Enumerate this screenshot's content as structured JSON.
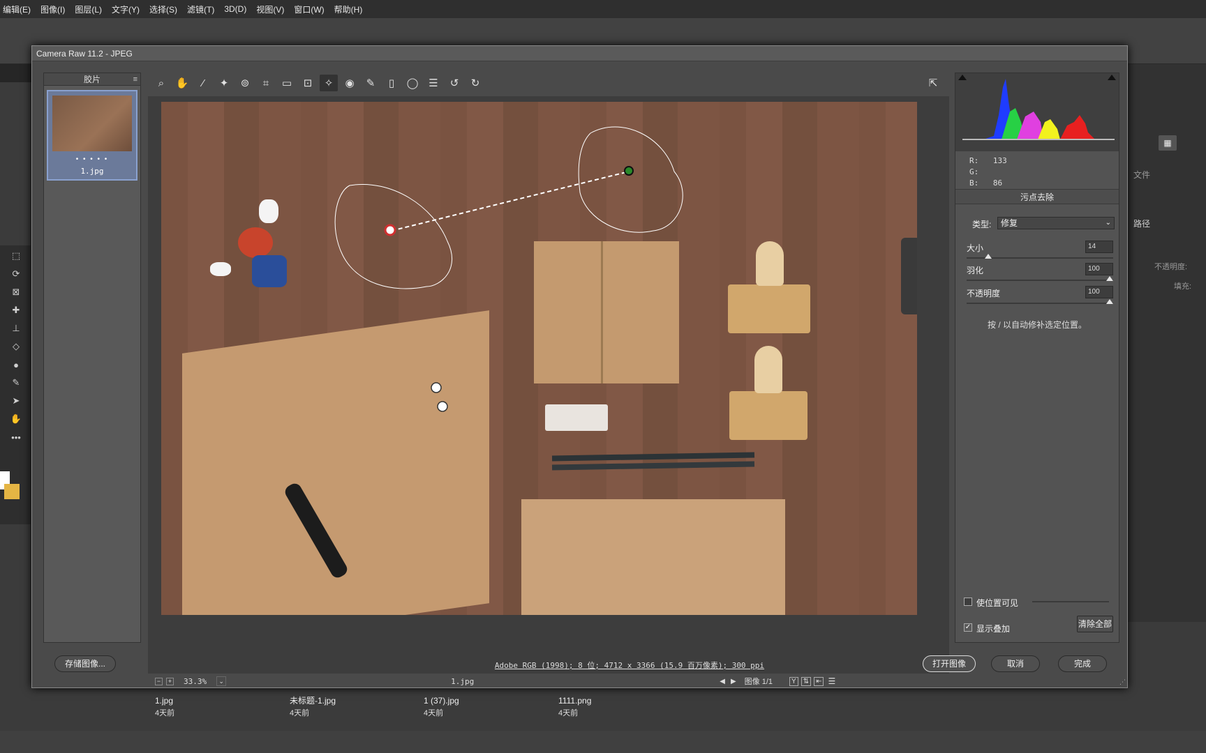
{
  "menubar": [
    "编辑(E)",
    "图像(I)",
    "图层(L)",
    "文字(Y)",
    "选择(S)",
    "滤镜(T)",
    "3D(D)",
    "视图(V)",
    "窗口(W)",
    "帮助(H)"
  ],
  "dialog": {
    "title": "Camera Raw 11.2 -  JPEG",
    "filmstrip": {
      "header": "胶片",
      "thumb_name": "1.jpg",
      "dots": "• • • • •"
    },
    "toolbar_icons": [
      "zoom-icon",
      "hand-icon",
      "white-balance-icon",
      "color-sampler-icon",
      "target-adjust-icon",
      "crop-icon",
      "straighten-icon",
      "transform-icon",
      "spot-removal-icon",
      "red-eye-icon",
      "adjustment-brush-icon",
      "graduated-filter-icon",
      "radial-filter-icon",
      "preferences-icon",
      "rotate-ccw-icon",
      "rotate-cw-icon"
    ],
    "canvas": {
      "zoom": "33.3%",
      "filename": "1.jpg",
      "image_counter": "图像 1/1"
    },
    "rgb": {
      "r_label": "R:",
      "r": "133",
      "g_label": "G:",
      "g": "",
      "b_label": "B:",
      "b": "86"
    },
    "panel": {
      "title": "污点去除",
      "type_label": "类型:",
      "type_value": "修复",
      "size_label": "大小",
      "size_value": "14",
      "feather_label": "羽化",
      "feather_value": "100",
      "opacity_label": "不透明度",
      "opacity_value": "100",
      "hint": "按 / 以自动修补选定位置。",
      "visualize_label": "使位置可见",
      "overlay_label": "显示叠加",
      "clear_all": "清除全部"
    },
    "footer": {
      "save": "存储图像...",
      "info": "Adobe RGB (1998); 8 位; 4712 x 3366 (15.9 百万像素); 300 ppi",
      "open": "打开图像",
      "cancel": "取消",
      "done": "完成"
    }
  },
  "ps_right": {
    "tab_label": "路径",
    "opacity_label": "不透明度:",
    "fill_label": "填充:",
    "file_hint": "文件"
  },
  "recent_files": [
    {
      "name": "1.jpg",
      "time": "4天前"
    },
    {
      "name": "未标题-1.jpg",
      "time": "4天前"
    },
    {
      "name": "1 (37).jpg",
      "time": "4天前"
    },
    {
      "name": "1111.png",
      "time": "4天前"
    }
  ],
  "colors": {
    "accent": "#8aa1cf",
    "spot_source": "#2a8a2a",
    "spot_target": "#d03030"
  }
}
